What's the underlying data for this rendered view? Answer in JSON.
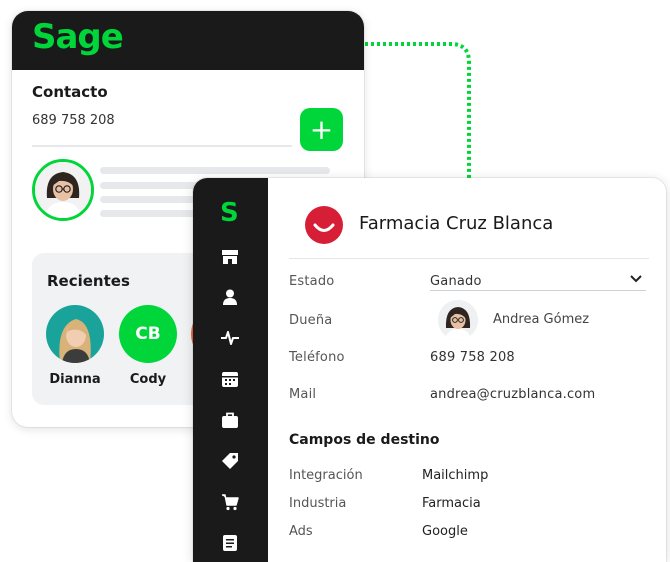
{
  "colors": {
    "brand_green": "#00d639",
    "dark": "#1a1a1a",
    "brand_red": "#d61f36"
  },
  "left_card": {
    "logo": "Sage",
    "contact_label": "Contacto",
    "contact_phone": "689 758 208",
    "add_button_label": "+",
    "recent_title": "Recientes",
    "recent": [
      {
        "name": "Dianna",
        "initials": ""
      },
      {
        "name": "Cody",
        "initials": "CB"
      }
    ]
  },
  "sidebar": {
    "logo": "S",
    "icons": [
      "store-icon",
      "user-icon",
      "activity-icon",
      "calendar-icon",
      "briefcase-icon",
      "tag-icon",
      "cart-icon",
      "document-icon"
    ]
  },
  "detail": {
    "company_name": "Farmacia Cruz Blanca",
    "rows": {
      "estado_label": "Estado",
      "estado_value": "Ganado",
      "duena_label": "Dueña",
      "duena_value": "Andrea Gómez",
      "telefono_label": "Teléfono",
      "telefono_value": "689 758 208",
      "mail_label": "Mail",
      "mail_value": "andrea@cruzblanca.com"
    },
    "section_title": "Campos de destino",
    "fields": [
      {
        "label": "Integración",
        "value": "Mailchimp"
      },
      {
        "label": "Industria",
        "value": "Farmacia"
      },
      {
        "label": "Ads",
        "value": "Google"
      }
    ]
  }
}
